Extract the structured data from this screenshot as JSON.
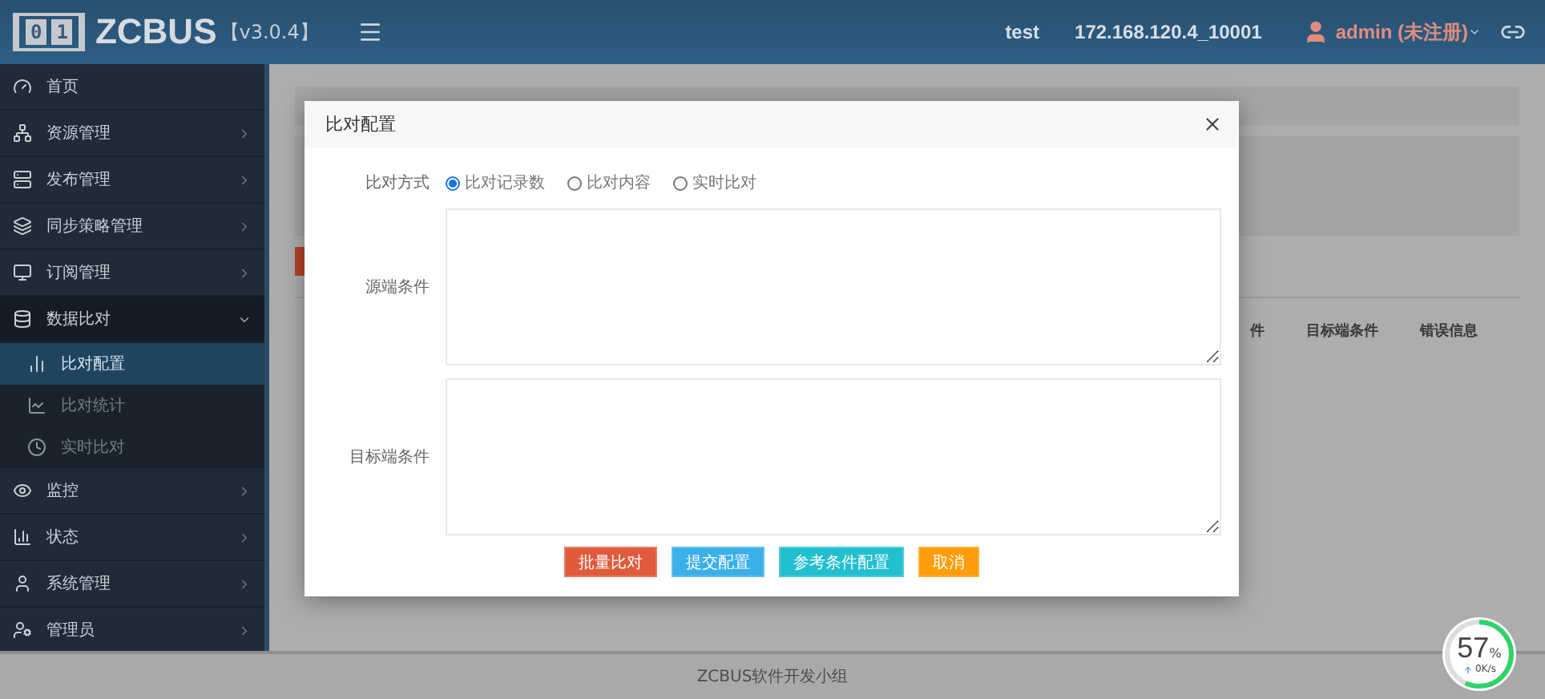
{
  "header": {
    "logo_digits": [
      "0",
      "1"
    ],
    "brand": "ZCBUS",
    "version": "【v3.0.4】",
    "env": "test",
    "server": "172.168.120.4_10001",
    "user": "admin (未注册)"
  },
  "sidebar": {
    "items": [
      {
        "label": "首页",
        "has_children": false,
        "expanded": false
      },
      {
        "label": "资源管理",
        "has_children": true,
        "expanded": false
      },
      {
        "label": "发布管理",
        "has_children": true,
        "expanded": false
      },
      {
        "label": "同步策略管理",
        "has_children": true,
        "expanded": false
      },
      {
        "label": "订阅管理",
        "has_children": true,
        "expanded": false
      },
      {
        "label": "数据比对",
        "has_children": true,
        "expanded": true,
        "children": [
          {
            "label": "比对配置",
            "selected": true
          },
          {
            "label": "比对统计",
            "selected": false
          },
          {
            "label": "实时比对",
            "selected": false
          }
        ]
      },
      {
        "label": "监控",
        "has_children": true,
        "expanded": false
      },
      {
        "label": "状态",
        "has_children": true,
        "expanded": false
      },
      {
        "label": "系统管理",
        "has_children": true,
        "expanded": false
      },
      {
        "label": "管理员",
        "has_children": true,
        "expanded": false
      }
    ]
  },
  "background_table": {
    "columns": [
      "件",
      "目标端条件",
      "错误信息"
    ]
  },
  "dialog": {
    "title": "比对配置",
    "mode_label": "比对方式",
    "modes": [
      {
        "label": "比对记录数",
        "selected": true
      },
      {
        "label": "比对内容",
        "selected": false
      },
      {
        "label": "实时比对",
        "selected": false
      }
    ],
    "source_label": "源端条件",
    "target_label": "目标端条件",
    "buttons": [
      {
        "label": "批量比对",
        "kind": "danger"
      },
      {
        "label": "提交配置",
        "kind": "primary"
      },
      {
        "label": "参考条件配置",
        "kind": "info"
      },
      {
        "label": "取消",
        "kind": "warning"
      }
    ]
  },
  "footer": {
    "text": "ZCBUS软件开发小组"
  },
  "speed_widget": {
    "percent": "57",
    "unit": "%",
    "speed": "0K/s",
    "level": 0.57
  }
}
